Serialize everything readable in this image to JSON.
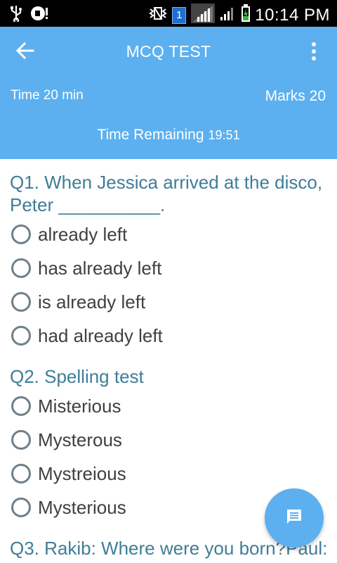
{
  "status_bar": {
    "time": "10:14 PM",
    "sim_number": "1",
    "icons": [
      "usb-icon",
      "notification-icon",
      "vibrate-icon",
      "sim-icon",
      "signal-icon",
      "signal-icon",
      "battery-charging-icon"
    ]
  },
  "app_bar": {
    "title": "MCQ TEST",
    "time_label": "Time 20 min",
    "marks_label": "Marks 20",
    "remaining_label": "Time Remaining",
    "remaining_value": "19:51",
    "background_color": "#5cb0ef"
  },
  "questions": [
    {
      "text": "Q1. When Jessica arrived at the disco, Peter __________.",
      "options": [
        "already left",
        "has already left",
        "is already left",
        "had already left"
      ]
    },
    {
      "text": "Q2. Spelling test",
      "options": [
        "Misterious",
        "Mysterous",
        "Mystreious",
        "Mysterious"
      ]
    },
    {
      "text": "Q3. Rakib: Where were you born?Paul:"
    }
  ],
  "colors": {
    "question_text": "#3f7d97",
    "option_text": "#404040",
    "radio_border": "#6e808a"
  }
}
